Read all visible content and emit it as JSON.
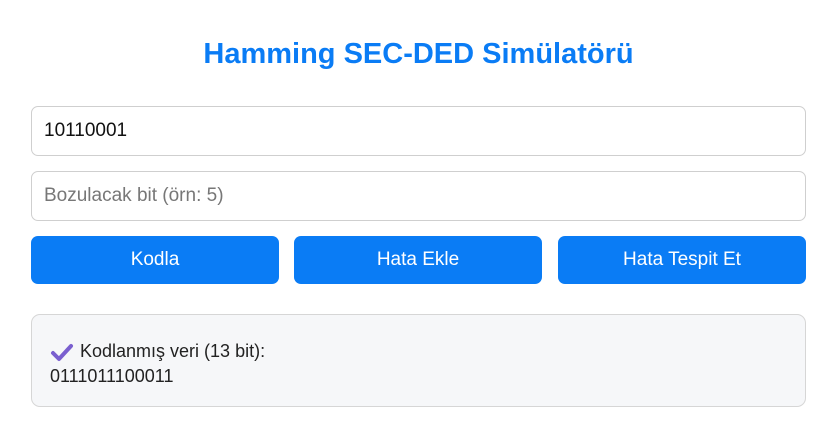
{
  "page": {
    "title": "Hamming SEC-DED Simülatörü"
  },
  "inputs": {
    "data_value": "10110001",
    "bit_placeholder": "Bozulacak bit (örn: 5)",
    "bit_value": ""
  },
  "buttons": {
    "encode_label": "Kodla",
    "inject_label": "Hata Ekle",
    "detect_label": "Hata Tespit Et"
  },
  "output": {
    "icon": "check-mark-icon",
    "label": "Kodlanmış veri (13 bit):",
    "value": "0111011100011"
  },
  "colors": {
    "accent": "#0a7cf5",
    "check": "#7a5fcf"
  }
}
